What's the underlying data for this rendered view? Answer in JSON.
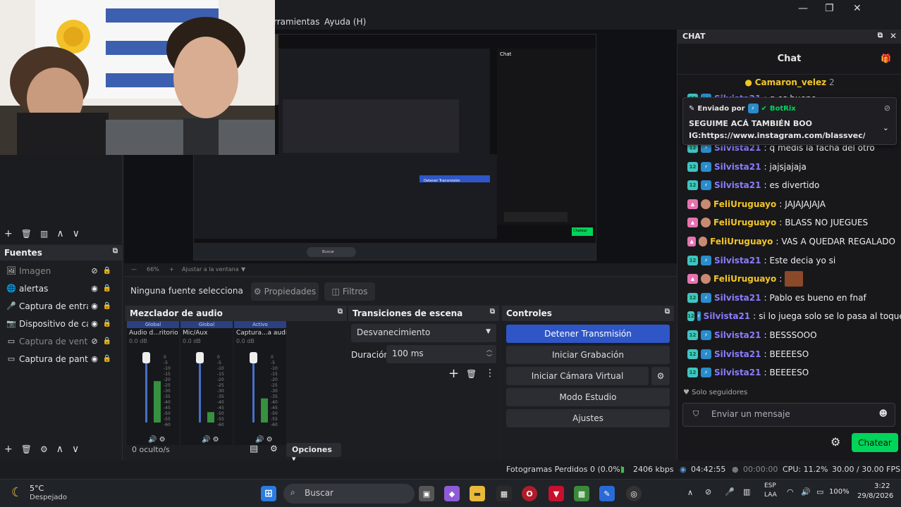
{
  "menu": {
    "herramientas": "rramientas",
    "ayuda": "Ayuda (H)"
  },
  "window_controls": {
    "min": "—",
    "max": "❐",
    "close": "✕"
  },
  "preview": {
    "zoom_value": "66%",
    "fit_label": "Ajustar a la ventana",
    "nested": {
      "chat_title": "Chat",
      "controls": [
        "Detener Transmisión",
        "Iniciar Grabación",
        "Iniciar Cámara Virtual",
        "Modo Estudio",
        "Ajustes"
      ],
      "search": "Buscar",
      "chat_send": "Chatear"
    }
  },
  "scenes_toolbar": {
    "add": "+",
    "remove": "🗑",
    "filter": "▥",
    "up": "∧",
    "down": "∨"
  },
  "sources": {
    "title": "Fuentes",
    "items": [
      {
        "icon": "image-icon",
        "glyph": "🖼",
        "label": "Imagen",
        "visible": false
      },
      {
        "icon": "globe-icon",
        "glyph": "🌐",
        "label": "alertas",
        "visible": true
      },
      {
        "icon": "mic-icon",
        "glyph": "🎤",
        "label": "Captura de entrada",
        "visible": true
      },
      {
        "icon": "camera-icon",
        "glyph": "📷",
        "label": "Dispositivo de captu",
        "visible": true
      },
      {
        "icon": "window-icon",
        "glyph": "▭",
        "label": "Captura de ventana",
        "visible": false
      },
      {
        "icon": "monitor-icon",
        "glyph": "▭",
        "label": "Captura de pantalla",
        "visible": true
      }
    ],
    "toolbar": {
      "add": "+",
      "remove": "🗑",
      "settings": "⚙",
      "up": "∧",
      "down": "∨"
    }
  },
  "source_toolbar": {
    "no_source": "Ninguna fuente selecciona",
    "properties": "Propiedades",
    "filters": "Filtros"
  },
  "mixer": {
    "title": "Mezclador de audio",
    "channels": [
      {
        "group": "Global",
        "name": "Audio d...ritorio",
        "db": "0.0 dB",
        "level": 0.6
      },
      {
        "group": "Global",
        "name": "Mic/Aux",
        "db": "0.0 dB",
        "level": 0.15
      },
      {
        "group": "Activo",
        "name": "Captura...a audio",
        "db": "0.0 dB",
        "level": 0.35
      }
    ],
    "scale": [
      "0",
      "-5",
      "-10",
      "-15",
      "-20",
      "-25",
      "-30",
      "-35",
      "-40",
      "-45",
      "-50",
      "-55",
      "-60"
    ],
    "hidden": "0 oculto/s",
    "options": "Opciones"
  },
  "transitions": {
    "title": "Transiciones de escena",
    "selected": "Desvanecimiento",
    "duration_label": "Duración",
    "duration_value": "100 ms"
  },
  "controls": {
    "title": "Controles",
    "stop_stream": "Detener Transmisión",
    "start_recording": "Iniciar Grabación",
    "start_virtual_cam": "Iniciar Cámara Virtual",
    "studio_mode": "Modo Estudio",
    "settings": "Ajustes"
  },
  "status": {
    "dropped": "Fotogramas Perdidos 0 (0.0%)",
    "bitrate": "2406 kbps",
    "live_time": "04:42:55",
    "rec_time": "00:00:00",
    "cpu": "CPU: 11.2%",
    "fps": "30.00 / 30.00 FPS"
  },
  "chat": {
    "panel_title": "CHAT",
    "header": "Chat",
    "top_user": "Camaron_velez",
    "top_count": "2",
    "pinned": {
      "sent_by_label": "Enviado por",
      "bot": "BotRix",
      "line1": "SEGUIME ACÁ TAMBIÉN BOO",
      "line2": "IG:https://www.instagram.com/blassvec/..."
    },
    "peek_message": {
      "user": "Silvista21",
      "text": "q es bueno"
    },
    "messages": [
      {
        "user": "Silvista21",
        "color": "#8a7dff",
        "badge": "sub",
        "text": "q medis la facha del otro"
      },
      {
        "user": "Silvista21",
        "color": "#8a7dff",
        "badge": "sub",
        "text": "jajsjajaja"
      },
      {
        "user": "Silvista21",
        "color": "#8a7dff",
        "badge": "sub",
        "text": "es divertido"
      },
      {
        "user": "FeliUruguayo",
        "color": "#f3c626",
        "badge": "pink",
        "text": "JAJAJAJAJA"
      },
      {
        "user": "FeliUruguayo",
        "color": "#f3c626",
        "badge": "pink",
        "text": "BLASS NO JUEGUES"
      },
      {
        "user": "FeliUruguayo",
        "color": "#f3c626",
        "badge": "pink",
        "text": "VAS A QUEDAR REGALADO"
      },
      {
        "user": "Silvista21",
        "color": "#8a7dff",
        "badge": "sub",
        "text": "Este decia yo si"
      },
      {
        "user": "FeliUruguayo",
        "color": "#f3c626",
        "badge": "pink",
        "text": ""
      },
      {
        "user": "Silvista21",
        "color": "#8a7dff",
        "badge": "sub",
        "text": "Pablo es bueno en fnaf"
      },
      {
        "user": "Silvista21",
        "color": "#8a7dff",
        "badge": "sub",
        "text": "si lo juega solo se lo pasa al toque"
      },
      {
        "user": "Silvista21",
        "color": "#8a7dff",
        "badge": "sub",
        "text": "BESSSOOO"
      },
      {
        "user": "Silvista21",
        "color": "#8a7dff",
        "badge": "sub",
        "text": "BEEEESO"
      },
      {
        "user": "Silvista21",
        "color": "#8a7dff",
        "badge": "sub",
        "text": "BEEEESO"
      }
    ],
    "followers_only": "Solo seguidores",
    "input_placeholder": "Enviar un mensaje",
    "send": "Chatear"
  },
  "taskbar": {
    "weather_temp": "5°C",
    "weather_desc": "Despejado",
    "search": "Buscar",
    "lang_1": "ESP",
    "lang_2": "LAA",
    "battery": "100%",
    "time": "3:22",
    "date": "29/8/2026"
  },
  "colors": {
    "accent": "#2f56c6",
    "chat_send": "#00d45a",
    "user_blue": "#8a7dff",
    "user_gold": "#f3c626"
  }
}
